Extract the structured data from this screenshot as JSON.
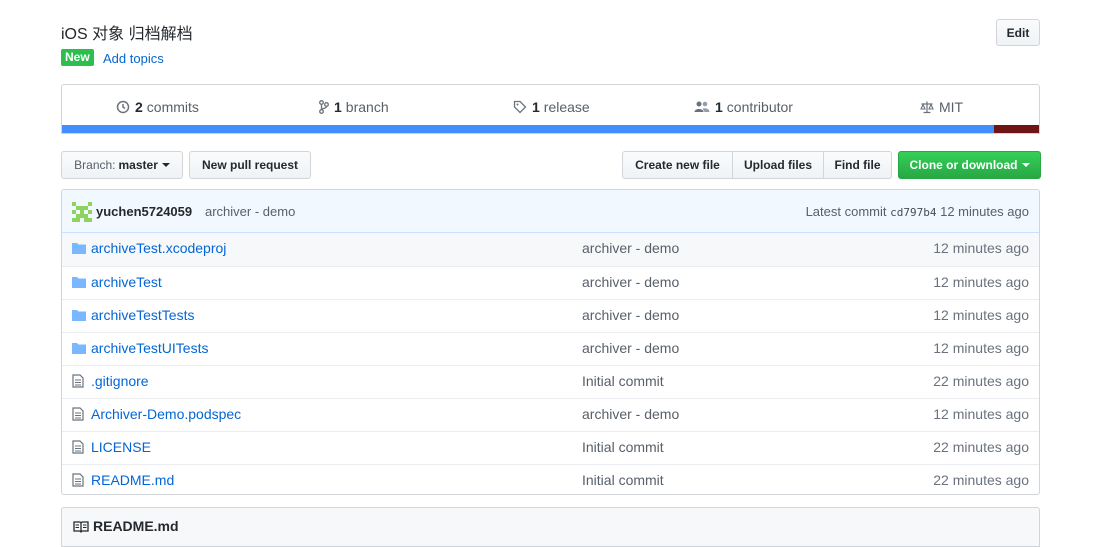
{
  "repo": {
    "title": "iOS 对象 归档解档",
    "new_badge": "New",
    "add_topics": "Add topics",
    "edit_label": "Edit"
  },
  "summary": {
    "commits": {
      "count": "2",
      "label": "commits"
    },
    "branches": {
      "count": "1",
      "label": "branch"
    },
    "releases": {
      "count": "1",
      "label": "release"
    },
    "contributors": {
      "count": "1",
      "label": "contributor"
    },
    "license": "MIT"
  },
  "languages": [
    {
      "color": "#438eff",
      "percent": 95.4
    },
    {
      "color": "#701516",
      "percent": 4.6
    }
  ],
  "toolbar": {
    "branch_prefix": "Branch:",
    "branch_name": "master",
    "new_pr": "New pull request",
    "create_file": "Create new file",
    "upload_files": "Upload files",
    "find_file": "Find file",
    "clone": "Clone or download"
  },
  "latest_commit": {
    "author": "yuchen5724059",
    "message": "archiver - demo",
    "prefix": "Latest commit",
    "sha": "cd797b4",
    "age": "12 minutes ago"
  },
  "files": [
    {
      "type": "dir",
      "name": "archiveTest.xcodeproj",
      "message": "archiver - demo",
      "age": "12 minutes ago"
    },
    {
      "type": "dir",
      "name": "archiveTest",
      "message": "archiver - demo",
      "age": "12 minutes ago"
    },
    {
      "type": "dir",
      "name": "archiveTestTests",
      "message": "archiver - demo",
      "age": "12 minutes ago"
    },
    {
      "type": "dir",
      "name": "archiveTestUITests",
      "message": "archiver - demo",
      "age": "12 minutes ago"
    },
    {
      "type": "file",
      "name": ".gitignore",
      "message": "Initial commit",
      "age": "22 minutes ago"
    },
    {
      "type": "file",
      "name": "Archiver-Demo.podspec",
      "message": "archiver - demo",
      "age": "12 minutes ago"
    },
    {
      "type": "file",
      "name": "LICENSE",
      "message": "Initial commit",
      "age": "22 minutes ago"
    },
    {
      "type": "file",
      "name": "README.md",
      "message": "Initial commit",
      "age": "22 minutes ago"
    }
  ],
  "readme": {
    "title": "README.md"
  },
  "colors": {
    "accent_link": "#0366d6",
    "green": "#2cbe4e",
    "folder": "#79b8ff"
  }
}
